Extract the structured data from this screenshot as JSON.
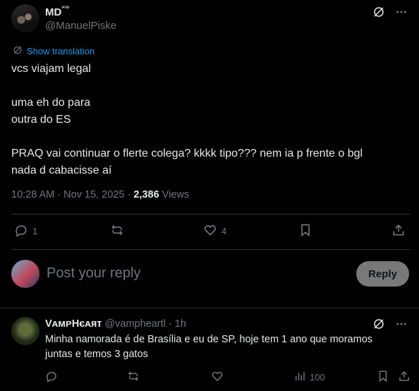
{
  "post": {
    "display_name": "MD",
    "name_superscript": "ˢᶜᶜᵖ",
    "handle": "@ManuelPiske",
    "translate_label": "Show translation",
    "text_lines": [
      "vcs viajam legal",
      "",
      "uma eh do para",
      "outra do ES",
      "",
      "PRAQ vai continuar o flerte colega? kkkk tipo??? nem ia p frente o bgl",
      "nada d cabacisse aí"
    ],
    "time": "10:28 AM",
    "date": "Nov 15, 2025",
    "views_count": "2,386",
    "views_label": "Views",
    "separator": "·",
    "actions": {
      "reply_count": "1",
      "repost_count": "",
      "like_count": "4"
    }
  },
  "composer": {
    "placeholder": "Post your reply",
    "button_label": "Reply"
  },
  "reply": {
    "display_name": "VᴀᴍᴘHєᴀят",
    "handle": "@vampheartl",
    "separator": "·",
    "time": "1h",
    "text": "Minha namorada é de Brasília e eu de SP, hoje tem 1 ano que moramos juntas  e temos 3 gatos",
    "views": "100"
  },
  "colors": {
    "background": "#000000",
    "text": "#e7e9ea",
    "muted": "#71767b",
    "link": "#1d9bf0",
    "divider": "#2f3336",
    "reply_button": "#787a7a"
  },
  "icons": [
    "grok-icon",
    "more-icon",
    "translate-icon",
    "reply-icon",
    "repost-icon",
    "like-icon",
    "bookmark-icon",
    "share-icon",
    "views-icon"
  ]
}
